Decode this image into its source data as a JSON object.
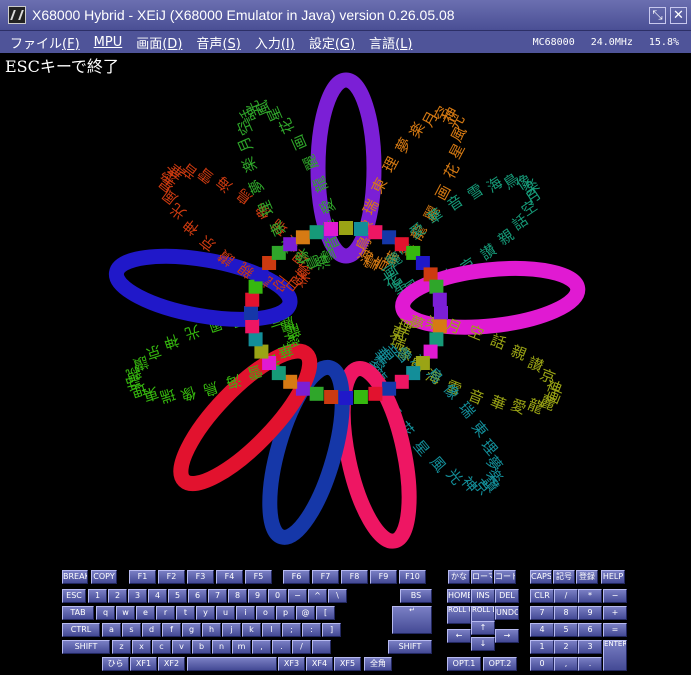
{
  "window": {
    "title": "X68000 Hybrid - XEiJ (X68000 Emulator in Java) version 0.26.05.08"
  },
  "menu": [
    {
      "name": "ファイル",
      "key": "(F)"
    },
    {
      "name": "MPU",
      "key": ""
    },
    {
      "name": "画面",
      "key": "(D)"
    },
    {
      "name": "音声",
      "key": "(S)"
    },
    {
      "name": "入力",
      "key": "(I)"
    },
    {
      "name": "設定",
      "key": "(G)"
    },
    {
      "name": "言語",
      "key": "(L)"
    }
  ],
  "status": {
    "cpu": "MC68000",
    "clock": "24.0MHz",
    "load": "15.8%"
  },
  "screen": {
    "message": "ESCキーで終了"
  },
  "colors": {
    "petals": [
      "#7b1fd6",
      "#d67a13",
      "#169a78",
      "#e01ad2",
      "#9aa415",
      "#138e99",
      "#ee1663",
      "#1537a8",
      "#e2122e",
      "#36b80f",
      "#2018c9",
      "#cc3a10",
      "#2fa62a"
    ]
  },
  "keyboard": {
    "keys": [
      "BREAK",
      "COPY",
      "F1",
      "F2",
      "F3",
      "F4",
      "F5",
      "F6",
      "F7",
      "F8",
      "F9",
      "F10",
      "かな",
      "ローマ",
      "コード",
      "CAPS",
      "記号",
      "登録",
      "HELP",
      "ESC",
      "1",
      "2",
      "3",
      "4",
      "5",
      "6",
      "7",
      "8",
      "9",
      "0",
      "−",
      "^",
      "\\",
      "BS",
      "HOME",
      "INS",
      "DEL",
      "CLR",
      "/",
      "*",
      "−",
      "TAB",
      "q",
      "w",
      "e",
      "r",
      "t",
      "y",
      "u",
      "i",
      "o",
      "p",
      "@",
      "[",
      "ROLL UP",
      "ROLL DOWN",
      "UNDO",
      "7",
      "8",
      "9",
      "+",
      "CTRL",
      "a",
      "s",
      "d",
      "f",
      "g",
      "h",
      "j",
      "k",
      "l",
      ";",
      ":",
      "]",
      "4",
      "5",
      "6",
      "=",
      "SHIFT",
      "z",
      "x",
      "c",
      "v",
      "b",
      "n",
      "m",
      ",",
      ".",
      "/",
      "",
      "SHIFT",
      "←",
      "↑",
      "→",
      "↓",
      "1",
      "2",
      "3",
      "ひら",
      "XF1",
      "XF2",
      "",
      "XF3",
      "XF4",
      "XF5",
      "全角",
      "OPT.1",
      "OPT.2",
      "0",
      ",",
      ".",
      "ENTER",
      "↵"
    ]
  }
}
